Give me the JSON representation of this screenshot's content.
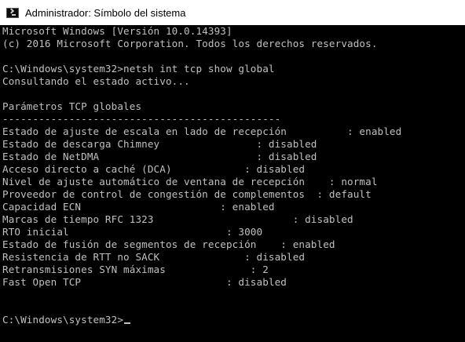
{
  "window": {
    "title": "Administrador: Símbolo del sistema",
    "icon": "console-app-icon"
  },
  "console": {
    "lines": [
      "Microsoft Windows [Versión 10.0.14393]",
      "(c) 2016 Microsoft Corporation. Todos los derechos reservados.",
      "",
      "C:\\Windows\\system32>netsh int tcp show global",
      "Consultando el estado activo...",
      "",
      "Parámetros TCP globales",
      "----------------------------------------------",
      "Estado de ajuste de escala en lado de recepción          : enabled",
      "Estado de descarga Chimney                : disabled",
      "Estado de NetDMA                          : disabled",
      "Acceso directo a caché (DCA)            : disabled",
      "Nivel de ajuste automático de ventana de recepción    : normal",
      "Proveedor de control de congestión de complementos  : default",
      "Capacidad ECN                       : enabled",
      "Marcas de tiempo RFC 1323                       : disabled",
      "RTO inicial                          : 3000",
      "Estado de fusión de segmentos de recepción    : enabled",
      "Resistencia de RTT no SACK              : disabled",
      "Retransmisiones SYN máximas              : 2",
      "Fast Open TCP                        : disabled",
      "",
      "",
      "C:\\Windows\\system32>"
    ]
  },
  "colors": {
    "background": "#000000",
    "text": "#c0c0c0",
    "titlebar": "#ffffff"
  }
}
